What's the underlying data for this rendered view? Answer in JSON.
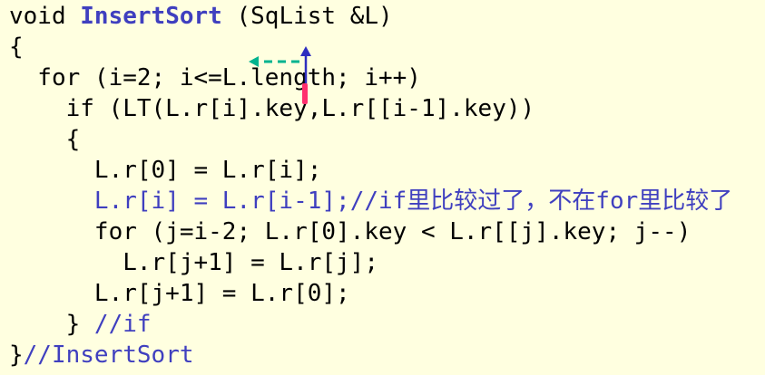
{
  "colors": {
    "background": "#FFFFE0",
    "text": "#000000",
    "accent_blue": "#3F3FBF",
    "dashed_arrow": "#00B38F",
    "up_arrow": "#2E2EBF",
    "marker": "#FF2F6F"
  },
  "code": {
    "l1_prefix": "void ",
    "l1_name": "InsertSort",
    "l1_suffix": " (SqList &L)",
    "l2": "{",
    "l3": "  for (i=2; i<=L.length; i++)",
    "l4": "    if (LT(L.r[i].key,L.r[[i-1].key))",
    "l5": "    {",
    "l6": "      L.r[0] = L.r[i];",
    "l7_code": "      L.r[i] = L.r[i-1];",
    "l7_comment": "//if里比较过了，不在for里比较了",
    "l8": "      for (j=i-2; L.r[0].key < L.r[[j].key; j--)",
    "l9": "        L.r[j+1] = L.r[j];",
    "l10": "      L.r[j+1] = L.r[0];",
    "l11_code": "    } ",
    "l11_comment": "//if",
    "l12_code": "}",
    "l12_comment": "//InsertSort"
  }
}
